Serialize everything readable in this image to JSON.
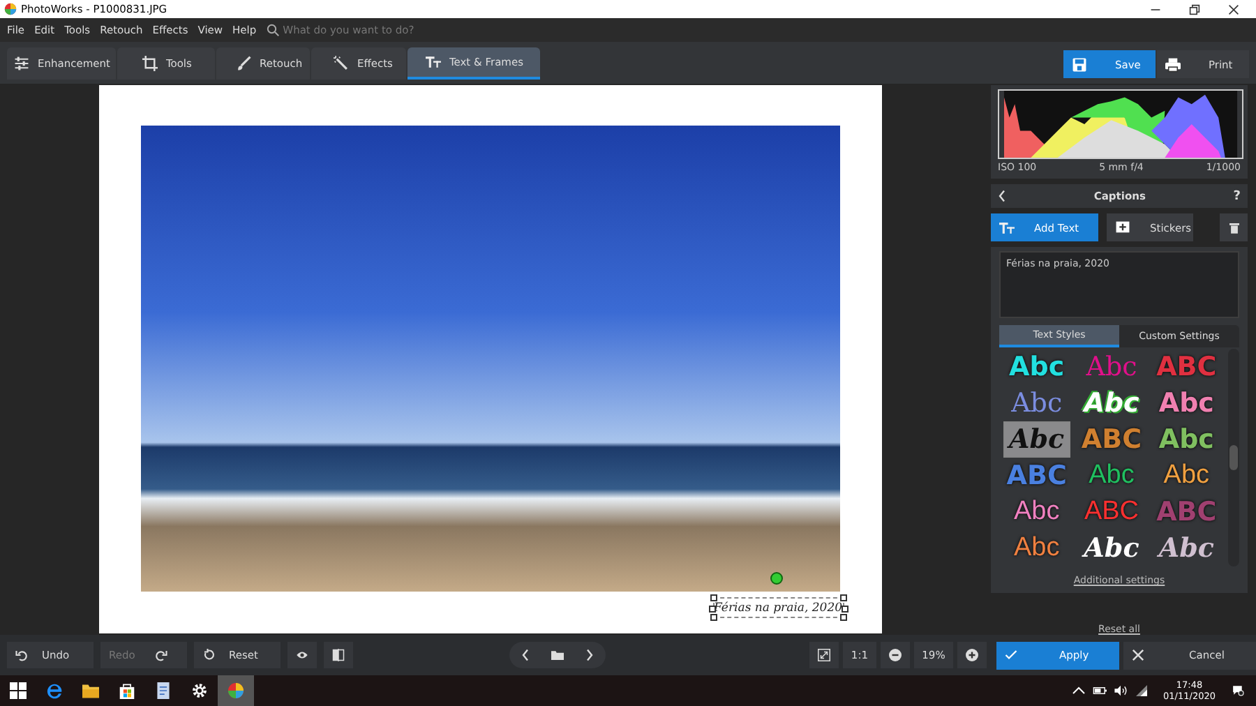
{
  "window": {
    "title": "PhotoWorks - P1000831.JPG"
  },
  "menu": [
    "File",
    "Edit",
    "Tools",
    "Retouch",
    "Effects",
    "View",
    "Help"
  ],
  "search": {
    "placeholder": "What do you want to do?"
  },
  "tabs": [
    {
      "label": "Enhancement",
      "selected": false
    },
    {
      "label": "Tools",
      "selected": false
    },
    {
      "label": "Retouch",
      "selected": false
    },
    {
      "label": "Effects",
      "selected": false
    },
    {
      "label": "Text & Frames",
      "selected": true
    }
  ],
  "actions": [
    {
      "label": "Save",
      "primary": true
    },
    {
      "label": "Print",
      "primary": false
    }
  ],
  "canvas": {
    "caption": "Férias na praia, 2020"
  },
  "exif": [
    "ISO 100",
    "5 mm f/4",
    "1/1000"
  ],
  "panel": {
    "title": "Captions",
    "help": "?",
    "modes": [
      {
        "label": "Add Text",
        "selected": true
      },
      {
        "label": "Stickers",
        "selected": false
      }
    ],
    "text_value": "Férias na praia, 2020",
    "subtabs": [
      {
        "label": "Text Styles",
        "selected": true
      },
      {
        "label": "Custom Settings",
        "selected": false
      }
    ],
    "styles": [
      {
        "text": "Abc",
        "kind": "bold",
        "color": "#22e0e0",
        "selected": false
      },
      {
        "text": "Abc",
        "kind": "serif",
        "color": "#e0108a",
        "selected": false
      },
      {
        "text": "ABC",
        "kind": "bold",
        "color": "#e03040",
        "selected": false
      },
      {
        "text": "Abc",
        "kind": "serif",
        "color": "#7b8de0",
        "selected": false
      },
      {
        "text": "Abc",
        "kind": "italic",
        "color": "#ffffff",
        "selected": false
      },
      {
        "text": "Abc",
        "kind": "bold",
        "color": "#f080b0",
        "selected": false
      },
      {
        "text": "Abc",
        "kind": "script",
        "color": "#111111",
        "selected": true
      },
      {
        "text": "ABC",
        "kind": "bold",
        "color": "#d08030",
        "selected": false
      },
      {
        "text": "Abc",
        "kind": "bold",
        "color": "#80c060",
        "selected": false
      },
      {
        "text": "ABC",
        "kind": "bold",
        "color": "#4a80e0",
        "selected": false
      },
      {
        "text": "Abc",
        "kind": "plain",
        "color": "#20c060",
        "selected": false
      },
      {
        "text": "Abc",
        "kind": "plain",
        "color": "#f0a040",
        "selected": false
      },
      {
        "text": "Abc",
        "kind": "plain",
        "color": "#f080c0",
        "selected": false
      },
      {
        "text": "ABC",
        "kind": "plain",
        "color": "#ff3030",
        "selected": false
      },
      {
        "text": "ABC",
        "kind": "bold",
        "color": "#a04070",
        "selected": false
      },
      {
        "text": "Abc",
        "kind": "plain",
        "color": "#f08040",
        "selected": false
      },
      {
        "text": "Abc",
        "kind": "script",
        "color": "#ffffff",
        "selected": false
      },
      {
        "text": "Abc",
        "kind": "script",
        "color": "#d0c0d0",
        "selected": false
      }
    ],
    "additional": "Additional settings",
    "reset": "Reset all",
    "apply": "Apply",
    "cancel": "Cancel"
  },
  "bottom": {
    "undo": {
      "label": "Undo",
      "disabled": false
    },
    "redo": {
      "label": "Redo",
      "disabled": true
    },
    "reset": "Reset",
    "zoom_1_1": "1:1",
    "zoom": "19%"
  },
  "taskbar": {
    "time": "17:48",
    "date": "01/11/2020"
  }
}
